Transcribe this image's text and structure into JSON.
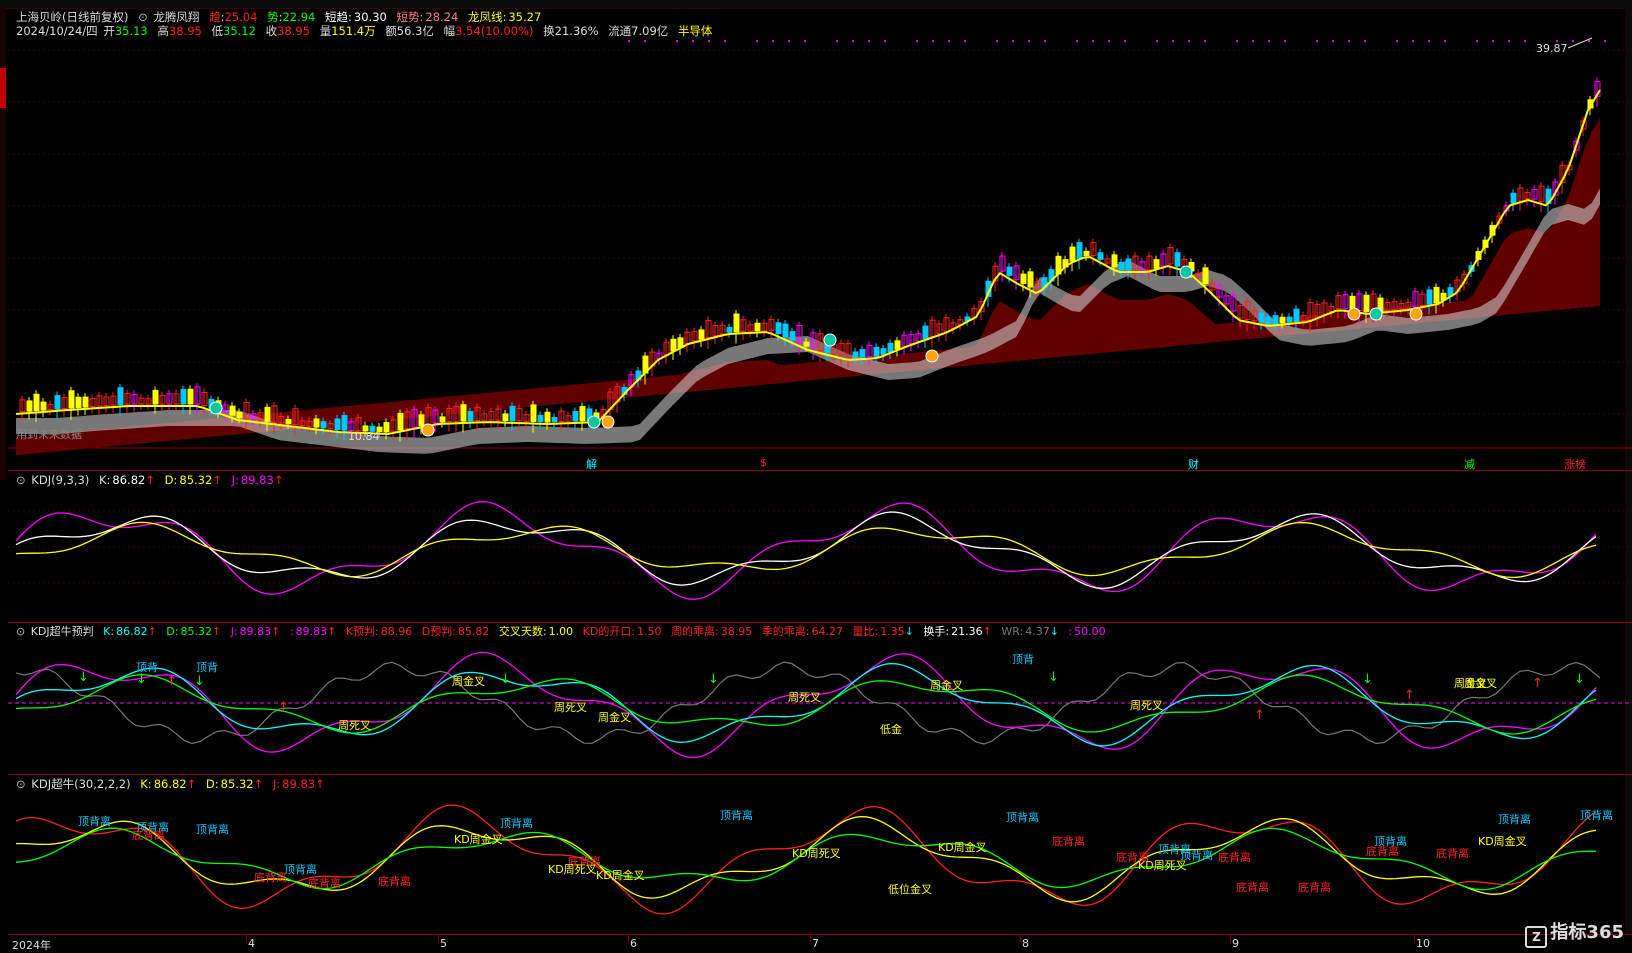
{
  "main": {
    "stock_name": "上海贝岭(日线前复权)",
    "indicator_name": "龙腾凤翔",
    "qu_label": "趋",
    "qu_value": "25.04",
    "shi_label": "势",
    "shi_value": "22.94",
    "duanqu_label": "短趋:",
    "duanqu_value": "30.30",
    "duanshi_label": "短势:",
    "duanshi_value": "28.24",
    "longfeng_label": "龙凤线:",
    "longfeng_value": "35.27",
    "date": "2024/10/24/四",
    "open_label": "开",
    "open_value": "35.13",
    "high_label": "高",
    "high_value": "38.95",
    "low_label": "低",
    "low_value": "35.12",
    "close_label": "收",
    "close_value": "38.95",
    "vol_label": "量",
    "vol_value": "151.4万",
    "amt_label": "额",
    "amt_value": "56.3亿",
    "chg_label": "幅",
    "chg_value": "3.54(10.00%)",
    "turn_label": "换",
    "turn_value": "21.36%",
    "float_label": "流通",
    "float_value": "7.09亿",
    "sector": "半导体",
    "high_mark": "39.87",
    "low_mark": "10.84",
    "future_note": "用到未来数据",
    "event_labels": [
      "解",
      "$",
      "财",
      "减",
      "涨榜"
    ]
  },
  "kdj": {
    "title": "KDJ(9,3,3)",
    "k_label": "K:",
    "k_value": "86.82",
    "d_label": "D:",
    "d_value": "85.32",
    "j_label": "J:",
    "j_value": "89.83"
  },
  "kdj_predict": {
    "title": "KDJ超牛预判",
    "k_label": "K:",
    "k_value": "86.82",
    "d_label": "D:",
    "d_value": "85.32",
    "j_label": "J:",
    "j_value": "89.83",
    "j2_label": ":",
    "j2_value": "89.83",
    "kp_label": "K预判:",
    "kp_value": "88.96",
    "dp_label": "D预判:",
    "dp_value": "85.82",
    "cross_label": "交叉天数:",
    "cross_value": "1.00",
    "open_label": "KD的开口:",
    "open_value": "1.50",
    "week_label": "周的乖离:",
    "week_value": "38.95",
    "month_label": "季的乖离:",
    "month_value": "64.27",
    "volr_label": "量比:",
    "volr_value": "1.35",
    "hand_label": "换手:",
    "hand_value": "21.36",
    "wr_label": "WR:",
    "wr_value": "4.37",
    "last_label": ":",
    "last_value": "50.00",
    "annotations": [
      "顶背",
      "顶背",
      "周金叉",
      "周死叉",
      "周死叉",
      "周金叉",
      "周金叉",
      "周死叉",
      "低金",
      "顶背",
      "周金叉",
      "周死叉",
      "周金叉"
    ]
  },
  "kdj_super": {
    "title": "KDJ超牛(30,2,2,2)",
    "k_label": "K:",
    "k_value": "86.82",
    "d_label": "D:",
    "d_value": "85.32",
    "j_label": "J:",
    "j_value": "89.83",
    "annotations_top": [
      "顶背离",
      "顶背离",
      "顶背离",
      "顶背离",
      "顶背离",
      "顶背离",
      "顶背离",
      "顶背离",
      "顶背离",
      "顶背离",
      "顶背离",
      "顶背离"
    ],
    "annotations_bottom": [
      "底背离",
      "底背离",
      "底背离",
      "底背离",
      "底背离",
      "底背离",
      "底背离",
      "底背离",
      "底背离",
      "底背离",
      "底背离",
      "底背离"
    ],
    "cross_labels": [
      "KD周金叉",
      "KD周死叉",
      "KD周金叉",
      "KD周死叉",
      "低位金叉",
      "KD周金叉",
      "KD周死叉",
      "KD周金叉"
    ]
  },
  "axis": {
    "labels": [
      "2024年",
      "4",
      "5",
      "6",
      "7",
      "8",
      "9",
      "10"
    ]
  },
  "brand": {
    "name": "指标365"
  },
  "colors": {
    "up": "#ff2020",
    "down": "#00c8ff",
    "ma_yellow": "#ffff00",
    "kdj_white": "#ffffff",
    "kdj_yellow": "#ffff00",
    "kdj_magenta": "#ff00ff",
    "grid": "#8a0000"
  }
}
